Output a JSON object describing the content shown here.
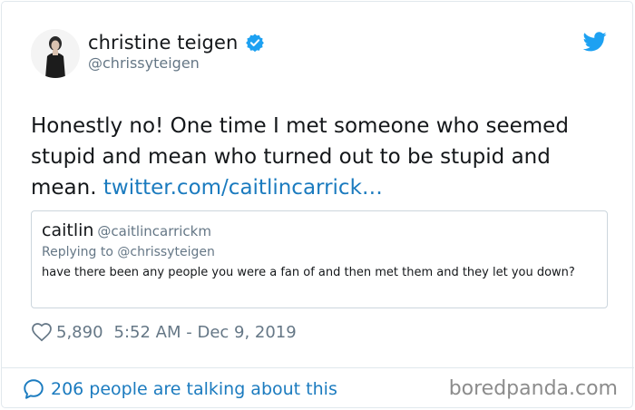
{
  "user": {
    "display_name": "christine teigen",
    "handle": "@chrissyteigen",
    "avatar_icon": "profile-photo"
  },
  "tweet": {
    "text": "Honestly no! One time I met someone who seemed stupid and mean who turned out to be stupid and mean.",
    "link": "twitter.com/caitlincarrick…",
    "likes": "5,890",
    "timestamp": "5:52 AM - Dec 9, 2019"
  },
  "quote": {
    "display_name": "caitlin",
    "handle": "@caitlincarrickm",
    "replying_to": "Replying to @chrissyteigen",
    "text": "have there been any people you were a fan of and then met them and they let you down?"
  },
  "footer": {
    "talking": "206 people are talking about this",
    "brand": "boredpanda.com"
  },
  "colors": {
    "link": "#1b7bbf",
    "verified": "#1da1f2",
    "twitter_bird": "#1da1f2",
    "muted": "#657786"
  },
  "icons": [
    "verified-badge-icon",
    "twitter-bird-icon",
    "heart-icon",
    "speech-bubble-icon"
  ]
}
